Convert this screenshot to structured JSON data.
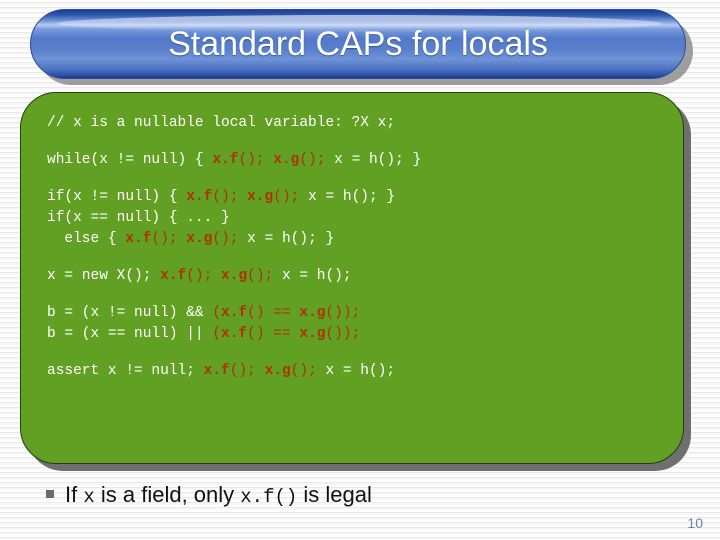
{
  "slide": {
    "title": "Standard CAPs for locals",
    "page_number": "10",
    "accent_blue": "#2d55ab",
    "panel_green": "#62a024",
    "highlight_red": "#ad3307",
    "title_text_color": "#ffffff",
    "code_text_color": "#ffffff",
    "page_number_color": "#6a7fae"
  },
  "code": {
    "blocks": [
      {
        "lines": [
          {
            "segments": [
              {
                "text": "// x is a nullable local variable: ?X x;",
                "style": "plain"
              }
            ]
          }
        ]
      },
      {
        "lines": [
          {
            "segments": [
              {
                "text": "while(x != null) { ",
                "style": "plain"
              },
              {
                "text": "x.f",
                "style": "hl"
              },
              {
                "text": "(); ",
                "style": "hl-plain"
              },
              {
                "text": "x.g",
                "style": "hl"
              },
              {
                "text": "(); ",
                "style": "hl-plain"
              },
              {
                "text": "x = h(); }",
                "style": "plain"
              }
            ]
          }
        ]
      },
      {
        "lines": [
          {
            "segments": [
              {
                "text": "if(x != null) { ",
                "style": "plain"
              },
              {
                "text": "x.f",
                "style": "hl"
              },
              {
                "text": "(); ",
                "style": "hl-plain"
              },
              {
                "text": "x.g",
                "style": "hl"
              },
              {
                "text": "(); ",
                "style": "hl-plain"
              },
              {
                "text": "x = h(); }",
                "style": "plain"
              }
            ]
          },
          {
            "segments": [
              {
                "text": "if(x == null) { ... }",
                "style": "plain"
              }
            ]
          },
          {
            "segments": [
              {
                "text": "  else { ",
                "style": "plain"
              },
              {
                "text": "x.f",
                "style": "hl"
              },
              {
                "text": "(); ",
                "style": "hl-plain"
              },
              {
                "text": "x.g",
                "style": "hl"
              },
              {
                "text": "(); ",
                "style": "hl-plain"
              },
              {
                "text": "x = h(); }",
                "style": "plain"
              }
            ]
          }
        ]
      },
      {
        "lines": [
          {
            "segments": [
              {
                "text": "x = new X(); ",
                "style": "plain"
              },
              {
                "text": "x.f",
                "style": "hl"
              },
              {
                "text": "(); ",
                "style": "hl-plain"
              },
              {
                "text": "x.g",
                "style": "hl"
              },
              {
                "text": "(); ",
                "style": "hl-plain"
              },
              {
                "text": "x = h();",
                "style": "plain"
              }
            ]
          }
        ]
      },
      {
        "lines": [
          {
            "segments": [
              {
                "text": "b = (x != null) && ",
                "style": "plain"
              },
              {
                "text": "(",
                "style": "hl-plain"
              },
              {
                "text": "x.f",
                "style": "hl"
              },
              {
                "text": "() == ",
                "style": "hl-plain"
              },
              {
                "text": "x.g",
                "style": "hl"
              },
              {
                "text": "());",
                "style": "hl-plain"
              }
            ]
          },
          {
            "segments": [
              {
                "text": "b = (x == null) || ",
                "style": "plain"
              },
              {
                "text": "(",
                "style": "hl-plain"
              },
              {
                "text": "x.f",
                "style": "hl"
              },
              {
                "text": "() == ",
                "style": "hl-plain"
              },
              {
                "text": "x.g",
                "style": "hl"
              },
              {
                "text": "());",
                "style": "hl-plain"
              }
            ]
          }
        ]
      },
      {
        "lines": [
          {
            "segments": [
              {
                "text": "assert x != null; ",
                "style": "plain"
              },
              {
                "text": "x.f",
                "style": "hl"
              },
              {
                "text": "(); ",
                "style": "hl-plain"
              },
              {
                "text": "x.g",
                "style": "hl"
              },
              {
                "text": "(); ",
                "style": "hl-plain"
              },
              {
                "text": "x = h();",
                "style": "plain"
              }
            ]
          }
        ]
      }
    ]
  },
  "bullet": {
    "marker": "square-bullet",
    "part1": "If ",
    "code1": "x",
    "part2": " is a field, only ",
    "code2": "x.f()",
    "part3": " is legal"
  }
}
